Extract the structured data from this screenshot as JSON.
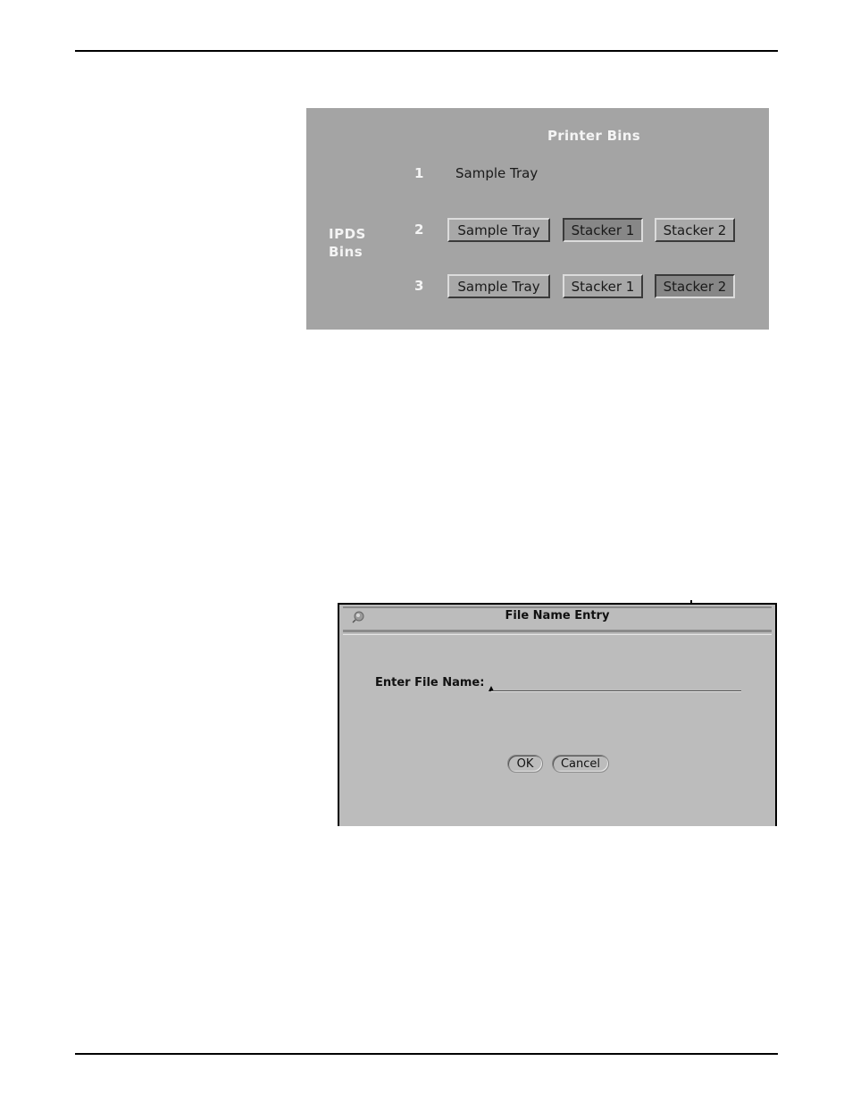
{
  "printer_bins_panel": {
    "title": "Printer Bins",
    "side_label_line1": "IPDS",
    "side_label_line2": "Bins",
    "colors": {
      "panel_bg": "#a4a4a4",
      "selected_bg": "#878787",
      "header_text": "#f4f4f4"
    },
    "rows": [
      {
        "number": "1",
        "static_label": "Sample Tray",
        "buttons": []
      },
      {
        "number": "2",
        "buttons": [
          {
            "label": "Sample Tray",
            "selected": false
          },
          {
            "label": "Stacker 1",
            "selected": true
          },
          {
            "label": "Stacker 2",
            "selected": false
          }
        ]
      },
      {
        "number": "3",
        "buttons": [
          {
            "label": "Sample Tray",
            "selected": false
          },
          {
            "label": "Stacker 1",
            "selected": false
          },
          {
            "label": "Stacker 2",
            "selected": true
          }
        ]
      }
    ]
  },
  "file_name_dialog": {
    "title": "File Name Entry",
    "pin_icon": "pushpin-icon",
    "field_label": "Enter File Name:",
    "field_value": "",
    "ok_label": "OK",
    "cancel_label": "Cancel",
    "colors": {
      "dialog_bg": "#bcbcbc"
    }
  }
}
